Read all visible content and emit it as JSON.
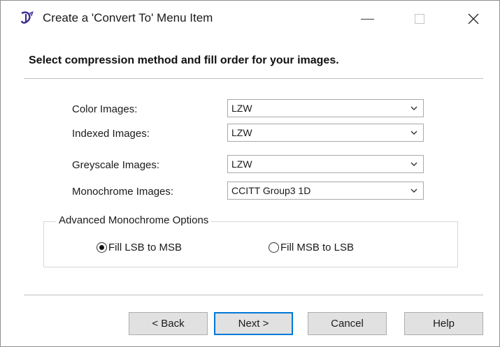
{
  "window": {
    "title": "Create a 'Convert To' Menu Item",
    "icon": "app-icon"
  },
  "heading": "Select compression method and fill order for your images.",
  "rows": [
    {
      "label": "Color Images:",
      "value": "LZW"
    },
    {
      "label": "Indexed Images:",
      "value": "LZW"
    },
    {
      "label": "Greyscale Images:",
      "value": "LZW"
    },
    {
      "label": "Monochrome Images:",
      "value": "CCITT Group3 1D"
    }
  ],
  "advanced": {
    "title": "Advanced Monochrome Options",
    "options": [
      {
        "label": "Fill LSB to MSB",
        "selected": true
      },
      {
        "label": "Fill MSB to LSB",
        "selected": false
      }
    ]
  },
  "buttons": {
    "back": "< Back",
    "next": "Next >",
    "cancel": "Cancel",
    "help": "Help"
  },
  "colors": {
    "accent": "#0078d7",
    "button_face": "#e1e1e1"
  }
}
